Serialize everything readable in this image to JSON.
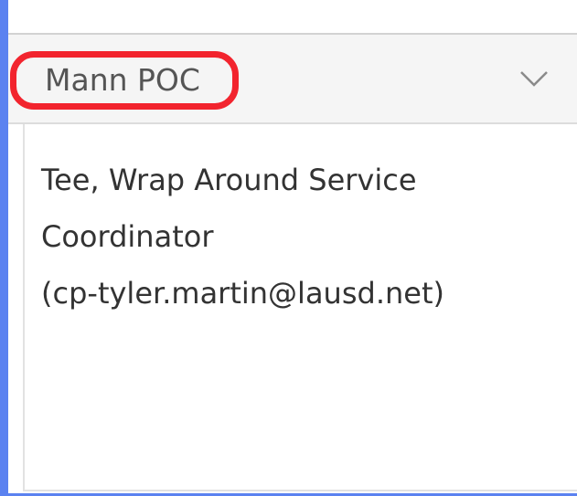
{
  "panel": {
    "header": {
      "title": "Mann POC",
      "toggle_icon": "chevron-down-icon"
    },
    "contact": {
      "line1": "Tee, Wrap Around Service",
      "line2": "Coordinator",
      "line3": "(cp-tyler.martin@lausd.net)"
    },
    "highlight_color": "#f2242e",
    "page_background": "#5b82f0"
  }
}
